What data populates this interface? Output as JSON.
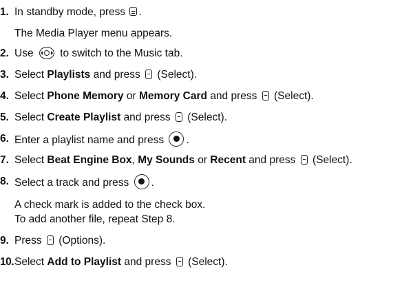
{
  "steps": [
    {
      "num": "1.",
      "t1": "In standby mode, press",
      "t2": ".",
      "icon": "menu-key-icon"
    },
    {
      "note": "The Media Player menu appears."
    },
    {
      "num": "2.",
      "t1": "Use",
      "t2": "to switch to the Music tab.",
      "icon": "navigation-key-icon"
    },
    {
      "num": "3.",
      "t1": "Select",
      "b1": "Playlists",
      "t2": "and press",
      "t3": "(Select)."
    },
    {
      "num": "4.",
      "t1": "Select",
      "b1": "Phone Memory",
      "t2": "or",
      "b2": "Memory Card",
      "t3": "and press",
      "t4": "(Select)."
    },
    {
      "num": "5.",
      "t1": "Select",
      "b1": "Create Playlist",
      "t2": "and press",
      "t3": "(Select)."
    },
    {
      "num": "6.",
      "t1": "Enter a playlist name and press",
      "t2": "."
    },
    {
      "num": "7.",
      "t1": "Select",
      "b1": "Beat Engine Box",
      "t2": ",",
      "b2": "My Sounds",
      "t3": "or",
      "b3": "Recent",
      "t4": "and press",
      "t5": "(Select)."
    },
    {
      "num": "8.",
      "t1": "Select a track and press",
      "t2": "."
    },
    {
      "note": "A check mark is added to the check box."
    },
    {
      "note": "To add another file, repeat Step 8."
    },
    {
      "num": "9.",
      "t1": "Press",
      "t2": "(Options)."
    },
    {
      "num": "10.",
      "t1": "Select",
      "b1": "Add to Playlist",
      "t2": "and press",
      "t3": "(Select)."
    }
  ]
}
